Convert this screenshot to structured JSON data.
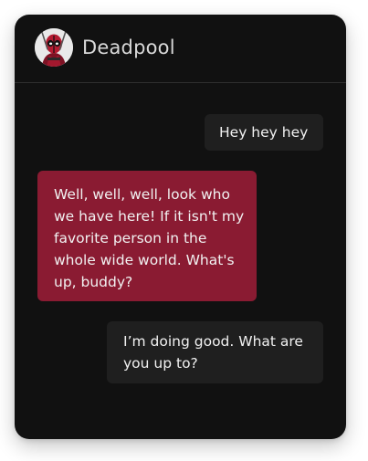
{
  "chat": {
    "contact_name": "Deadpool",
    "avatar_icon": "deadpool-avatar-icon",
    "colors": {
      "panel_bg": "#111111",
      "outgoing_bubble": "#1f1f1f",
      "incoming_bubble": "#8a1b32",
      "text": "#f1f1f1"
    },
    "messages": [
      {
        "direction": "outgoing",
        "text": "Hey hey hey"
      },
      {
        "direction": "incoming",
        "text": "Well, well, well, look who we have here! If it isn't my favorite person in the whole wide world. What's up, buddy?"
      },
      {
        "direction": "outgoing",
        "text": "I’m doing good. What are you up to?"
      }
    ]
  }
}
